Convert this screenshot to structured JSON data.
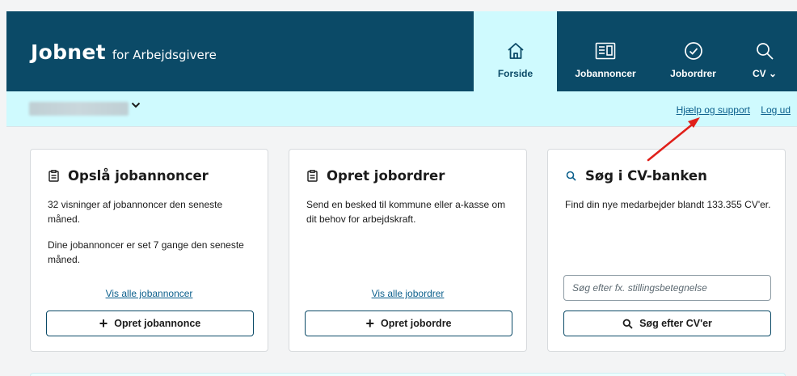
{
  "header": {
    "logo_main": "Jobnet",
    "logo_sub": "for Arbejdsgivere",
    "nav": [
      {
        "label": "Forside",
        "icon": "home-icon",
        "active": true
      },
      {
        "label": "Jobannoncer",
        "icon": "job-ads-icon",
        "active": false
      },
      {
        "label": "Jobordrer",
        "icon": "check-circle-icon",
        "active": false
      },
      {
        "label": "CV",
        "icon": "search-icon",
        "active": false,
        "has_dropdown": true
      }
    ]
  },
  "subbar": {
    "company_selector_icon": "chevron-down-icon",
    "help_link": "Hjælp og support",
    "logout_link": "Log ud"
  },
  "cards": [
    {
      "title": "Opslå jobannoncer",
      "icon": "clipboard-icon",
      "text1": "32 visninger af jobannoncer den seneste måned.",
      "text2": "Dine jobannoncer er set 7 gange den seneste måned.",
      "link": "Vis alle jobannoncer",
      "button": "Opret jobannonce"
    },
    {
      "title": "Opret jobordrer",
      "icon": "clipboard-icon",
      "text1": "Send en besked til kommune eller a-kasse om dit behov for arbejdskraft.",
      "link": "Vis alle jobordrer",
      "button": "Opret jobordre"
    },
    {
      "title": "Søg i CV-banken",
      "icon": "search-icon",
      "text1": "Find din nye medarbejder blandt 133.355 CV'er.",
      "search_placeholder": "Søg efter fx. stillingsbetegnelse",
      "button": "Søg efter CV'er"
    }
  ],
  "colors": {
    "header_bg": "#0b4a67",
    "active_tab_bg": "#cffafe",
    "subbar_bg": "#cffafe",
    "link": "#0b5f8c",
    "annotation_arrow": "#e0201a"
  }
}
